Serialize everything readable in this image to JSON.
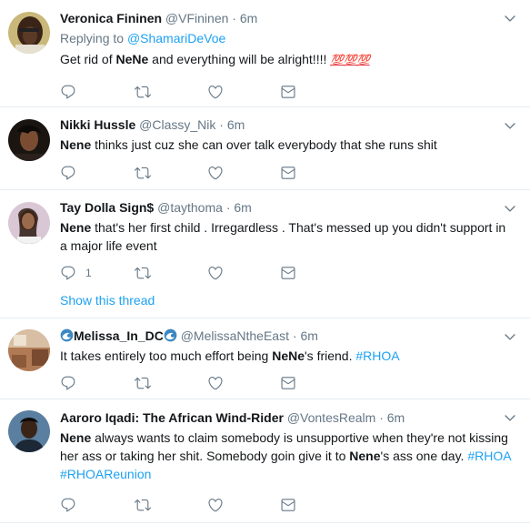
{
  "tweets": [
    {
      "name": "Veronica Fininen",
      "handle": "@VFininen",
      "dot": "·",
      "time": "6m",
      "replying_prefix": "Replying to ",
      "replying_handle": "@ShamariDeVoe",
      "text_parts": [
        "Get rid of ",
        "NeNe",
        " and everything will be alright!!!! "
      ],
      "emoji": "💯💯💯"
    },
    {
      "name": "Nikki Hussle",
      "handle": "@Classy_Nik",
      "dot": "·",
      "time": "6m",
      "text_parts": [
        "Nene",
        " thinks just cuz she can over talk everybody that she runs shit"
      ]
    },
    {
      "name": "Tay Dolla Sign$",
      "handle": "@taythoma",
      "dot": "·",
      "time": "6m",
      "text_parts": [
        "Nene",
        " that's her first child . Irregardless . That's messed up you didn't support in a major life event"
      ],
      "reply_count": "1",
      "show_thread": "Show this thread"
    },
    {
      "name": "Melissa_In_DC",
      "handle": "@MelissaNtheEast",
      "dot": "·",
      "time": "6m",
      "text_parts": [
        "It takes entirely too much effort being ",
        "NeNe",
        "'s friend. ",
        "#RHOA"
      ]
    },
    {
      "name": "Aaroro Iqadi: The African Wind-Rider",
      "handle": "@VontesRealm",
      "dot": "·",
      "time": "6m",
      "text_parts": [
        "Nene",
        " always wants to claim somebody is unsupportive when they're not kissing her ass or taking her shit. Somebody goin give it to ",
        "Nene",
        "'s ass one day. ",
        "#RHOA",
        " ",
        "#RHOAReunion"
      ]
    }
  ],
  "icons": {
    "reply": "reply-icon",
    "retweet": "retweet-icon",
    "like": "heart-icon",
    "dm": "envelope-icon",
    "caret": "chevron-down-icon",
    "wave": "wave-emoji-icon"
  },
  "colors": {
    "link": "#1da1f2",
    "secondary": "#657786",
    "text": "#14171a",
    "divider": "#e6ecf0"
  }
}
